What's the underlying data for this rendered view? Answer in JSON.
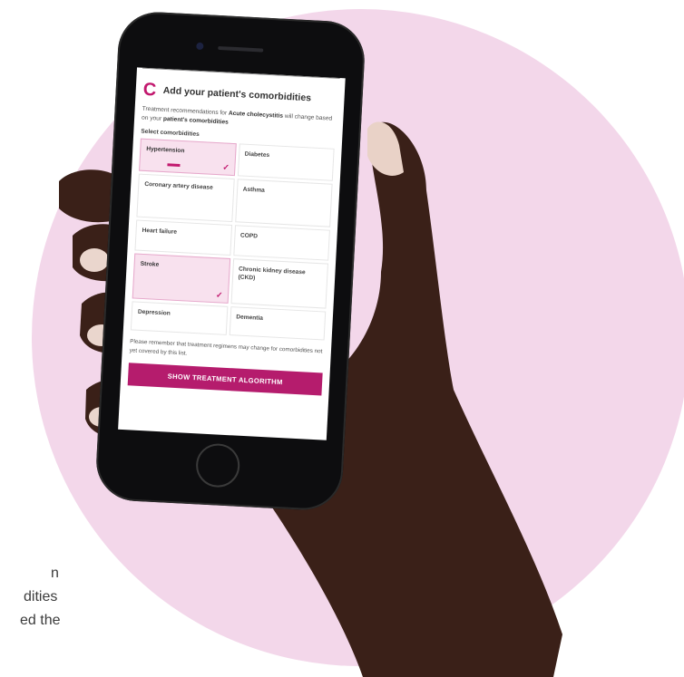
{
  "caption": {
    "line1": "n",
    "line2": "dities",
    "line3": "ed the"
  },
  "screen": {
    "title": "Add your patient's comorbidities",
    "description_prefix": "Treatment recommendations for ",
    "description_condition": "Acute cholecystitis",
    "description_mid": " will change based on your ",
    "description_suffix": "patient's comorbidities",
    "select_label": "Select comorbidities",
    "comorbidities": [
      {
        "label": "Hypertension",
        "selected": true
      },
      {
        "label": "Diabetes",
        "selected": false
      },
      {
        "label": "Coronary artery disease",
        "selected": false
      },
      {
        "label": "Asthma",
        "selected": false
      },
      {
        "label": "Heart failure",
        "selected": false
      },
      {
        "label": "COPD",
        "selected": false
      },
      {
        "label": "Stroke",
        "selected": true
      },
      {
        "label": "Chronic kidney disease (CKD)",
        "selected": false
      },
      {
        "label": "Depression",
        "selected": false
      },
      {
        "label": "Dementia",
        "selected": false
      }
    ],
    "note": "Please remember that treatment regimens may change for comorbidities not yet covered by this list.",
    "cta_label": "SHOW TREATMENT ALGORITHM"
  },
  "colors": {
    "accent": "#b51c6d",
    "circle": "#f3d7ea",
    "selected_bg": "#f8e1ee"
  },
  "icons": {
    "logo": "c-logo-icon",
    "check": "check-icon"
  }
}
